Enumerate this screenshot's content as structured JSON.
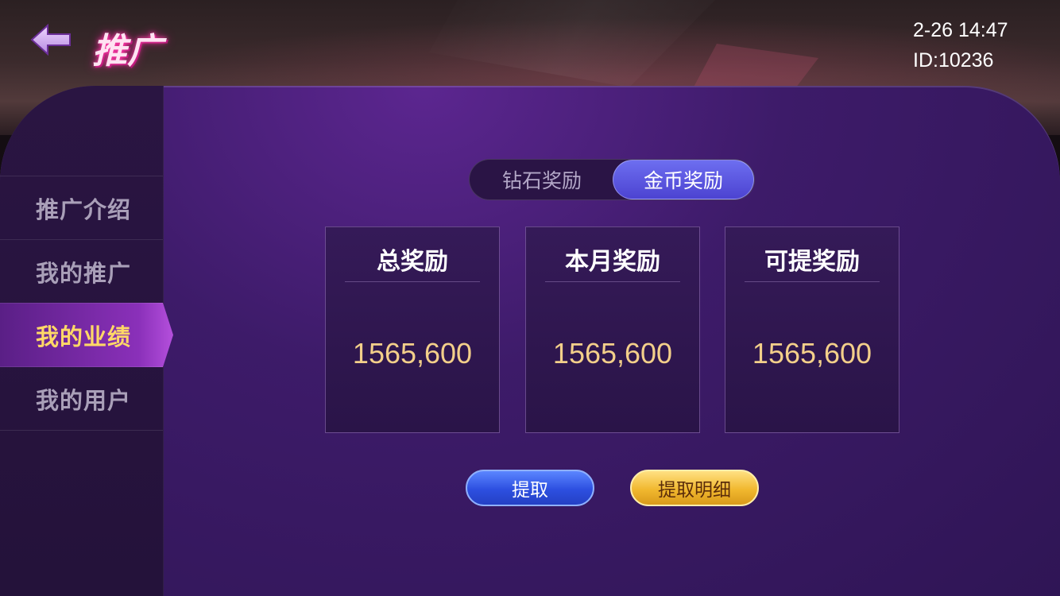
{
  "header": {
    "title": "推广",
    "datetime": "2-26 14:47",
    "user_id": "ID:10236",
    "back_icon": "back-arrow-icon"
  },
  "sidebar": {
    "items": [
      {
        "label": "推广介绍",
        "active": false
      },
      {
        "label": "我的推广",
        "active": false
      },
      {
        "label": "我的业绩",
        "active": true
      },
      {
        "label": "我的用户",
        "active": false
      }
    ]
  },
  "tabs": [
    {
      "label": "钻石奖励",
      "active": false
    },
    {
      "label": "金币奖励",
      "active": true
    }
  ],
  "cards": [
    {
      "title": "总奖励",
      "value": "1565,600"
    },
    {
      "title": "本月奖励",
      "value": "1565,600"
    },
    {
      "title": "可提奖励",
      "value": "1565,600"
    }
  ],
  "buttons": {
    "withdraw": "提取",
    "detail": "提取明细"
  },
  "colors": {
    "accent_purple": "#3d1b69",
    "active_tab": "#5b55e0",
    "value_gold": "#f3cf8a",
    "active_sidebar_text": "#ffd867"
  }
}
